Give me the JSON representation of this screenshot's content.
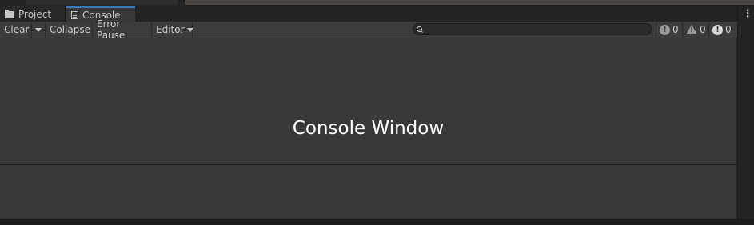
{
  "tabs": [
    {
      "label": "Project",
      "icon": "folder-icon",
      "active": false
    },
    {
      "label": "Console",
      "icon": "console-icon",
      "active": true
    }
  ],
  "menu_icon": "kebab-menu-icon",
  "toolbar": {
    "clear_label": "Clear",
    "collapse_label": "Collapse",
    "error_pause_label": "Error Pause",
    "editor_label": "Editor"
  },
  "search": {
    "value": "",
    "placeholder": ""
  },
  "counters": {
    "info": "0",
    "warning": "0",
    "error": "0"
  },
  "main": {
    "watermark_text": "Console Window"
  },
  "colors": {
    "active_tab_accent": "#3a79bb",
    "panel_background": "#383838",
    "toolbar_background": "#3c3c3c"
  }
}
